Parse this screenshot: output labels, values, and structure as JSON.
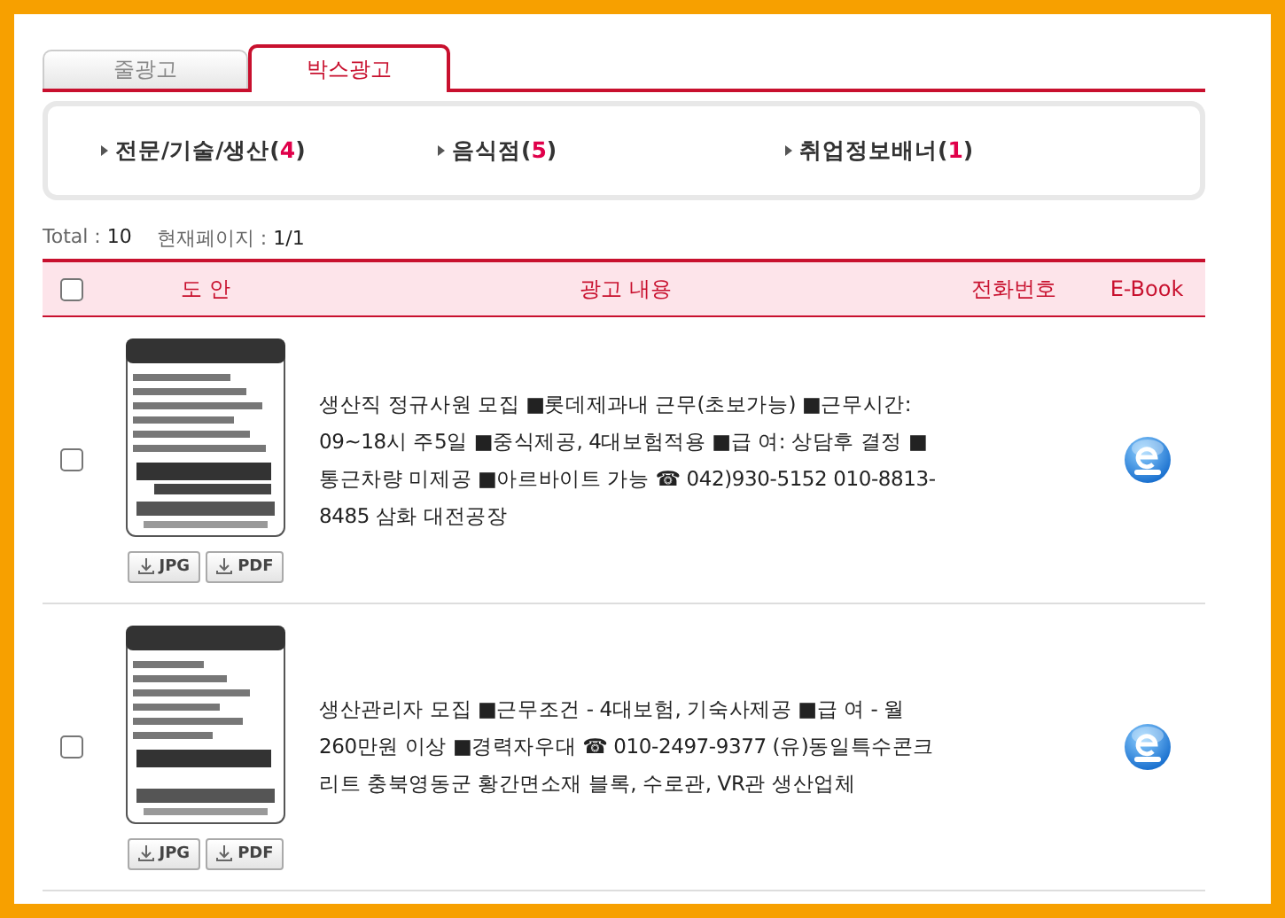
{
  "tabs": [
    {
      "label": "줄광고",
      "selected": false
    },
    {
      "label": "박스광고",
      "selected": true
    }
  ],
  "categories": [
    {
      "label": "전문/기술/생산",
      "open": "(",
      "count": "4",
      "close": ")"
    },
    {
      "label": "음식점",
      "open": "(",
      "count": "5",
      "close": ")"
    },
    {
      "label": "취업정보배너",
      "open": "(",
      "count": "1",
      "close": ")"
    }
  ],
  "summary": {
    "total_label": "Total :",
    "total": "10",
    "page_label": "현재페이지 :",
    "page": "1/1"
  },
  "table": {
    "select_all_checked": false,
    "columns": [
      "도 안",
      "광고 내용",
      "전화번호",
      "E-Book"
    ],
    "rows": [
      {
        "checked": false,
        "image": {
          "kind": "picture"
        },
        "downloads": [
          "JPG",
          "PDF"
        ],
        "content": "생산직 정규사원 모집 ■롯데제과내 근무(초보가능) ■근무시간: 09~18시 주5일 ■중식제공, 4대보험적용 ■급 여: 상담후 결정 ■통근차량 미제공 ■아르바이트 가능 ☎ 042)930-5152 010-8813-8485 삼화 대전공장"
      },
      {
        "checked": false,
        "image": {
          "kind": "picture"
        },
        "downloads": [
          "JPG",
          "PDF"
        ],
        "content": "생산관리자 모집 ■근무조건 - 4대보험, 기숙사제공 ■급 여 - 월260만원 이상 ■경력자우대 ☎ 010-2497-9377 (유)동일특수콘크리트 충북영동군 황간면소재 블록, 수로관, VR관 생산업체"
      }
    ]
  }
}
